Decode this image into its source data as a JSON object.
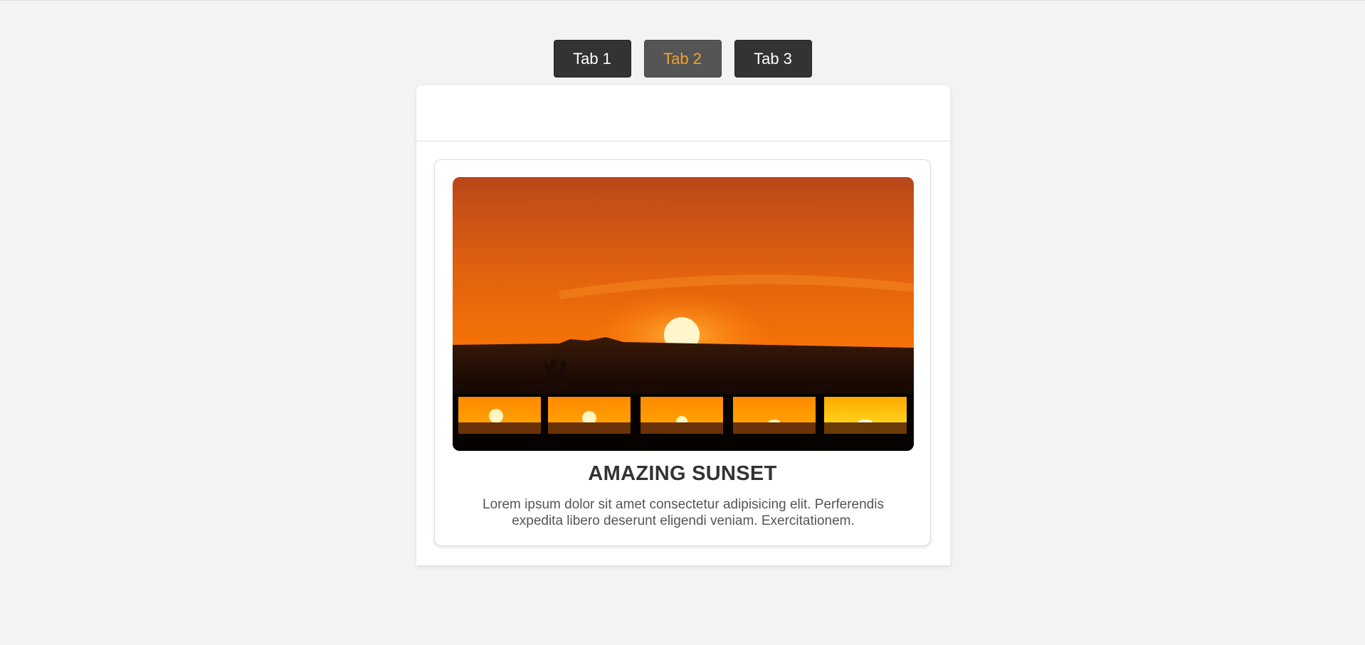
{
  "tabs": [
    {
      "label": "Tab 1",
      "active": false
    },
    {
      "label": "Tab 2",
      "active": true
    },
    {
      "label": "Tab 3",
      "active": false
    }
  ],
  "card": {
    "title": "AMAZING SUNSET",
    "description": "Lorem ipsum dolor sit amet consectetur adipisicing elit. Perferendis expedita libero deserunt eligendi veniam. Exercitationem."
  },
  "colors": {
    "tab_background": "#333333",
    "active_tab_background": "#555555",
    "active_tab_text": "#f5a12a",
    "page_background": "#f3f3f3"
  }
}
